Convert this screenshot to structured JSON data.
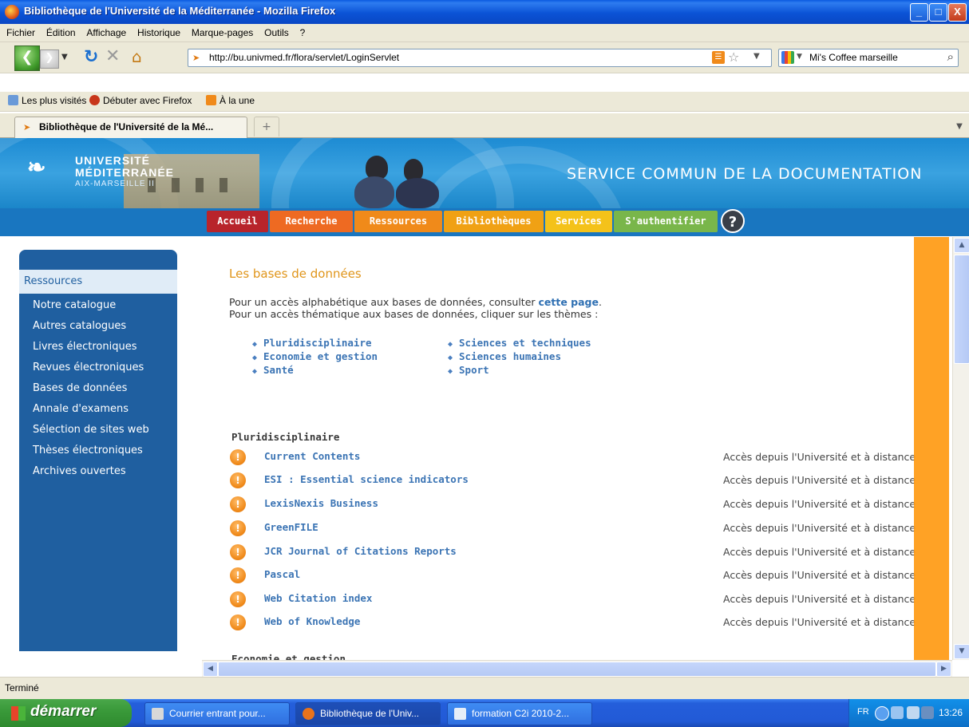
{
  "window": {
    "title": "Bibliothèque de l'Université de la Méditerranée - Mozilla Firefox",
    "controls": {
      "minimize": "_",
      "maximize": "□",
      "close": "X"
    }
  },
  "menubar": [
    "Fichier",
    "Édition",
    "Affichage",
    "Historique",
    "Marque-pages",
    "Outils",
    "?"
  ],
  "navbar": {
    "url": "http://bu.univmed.fr/flora/servlet/LoginServlet",
    "search_value": "Mi's Coffee marseille",
    "icons": [
      "back-icon",
      "forward-icon",
      "reload-icon",
      "stop-icon",
      "home-icon",
      "rss-icon",
      "star-icon",
      "search-icon"
    ]
  },
  "bookmarks": [
    "Les plus visités",
    "Débuter avec Firefox",
    "À la une"
  ],
  "tab": {
    "title": "Bibliothèque de l'Université de la Mé...",
    "new_tab": "+"
  },
  "site": {
    "logo": {
      "line1": "UNIVERSITÉ",
      "line2": "MÉDITERRANÉE",
      "line3": "AIX-MARSEILLE II"
    },
    "header_title": "SERVICE COMMUN DE LA DOCUMENTATION",
    "nav": [
      {
        "label": "Accueil",
        "color": "#b8242b"
      },
      {
        "label": "Recherche",
        "color": "#ee6a22"
      },
      {
        "label": "Ressources",
        "color": "#f08a1a"
      },
      {
        "label": "Bibliothèques",
        "color": "#f0a114"
      },
      {
        "label": "Services",
        "color": "#f4c21a"
      },
      {
        "label": "S'authentifier",
        "color": "#79b64a"
      }
    ],
    "help_label": "?"
  },
  "sidebar": {
    "heading": "Ressources",
    "items": [
      "Notre catalogue",
      "Autres catalogues",
      "Livres électroniques",
      "Revues électroniques",
      "Bases de données",
      "Annale d'examens",
      "Sélection de sites web",
      "Thèses électroniques",
      "Archives ouvertes"
    ]
  },
  "main": {
    "title": "Les bases de données",
    "intro1_pre": "Pour un accès alphabétique aux bases de données, consulter ",
    "intro1_link": "cette page",
    "intro1_post": ".",
    "intro2": "Pour un accès thématique aux bases de données, cliquer sur les thèmes :",
    "themes_left": [
      "Pluridisciplinaire",
      "Economie et gestion",
      "Santé"
    ],
    "themes_right": [
      "Sciences et techniques",
      "Sciences humaines",
      "Sport"
    ],
    "section_title": "Pluridisciplinaire",
    "access_text": "Accès depuis l'Université et à distance",
    "databases": [
      "Current Contents",
      "ESI : Essential science indicators",
      "LexisNexis Business",
      "GreenFILE",
      "JCR Journal of Citations Reports",
      "Pascal",
      "Web Citation index",
      "Web of Knowledge"
    ],
    "next_section": "Economie et gestion"
  },
  "statusbar": "Terminé",
  "taskbar": {
    "start": "démarrer",
    "tasks": [
      "Courrier entrant pour...",
      "Bibliothèque de l'Univ...",
      "formation C2i 2010-2..."
    ],
    "lang": "FR",
    "clock": "13:26"
  }
}
